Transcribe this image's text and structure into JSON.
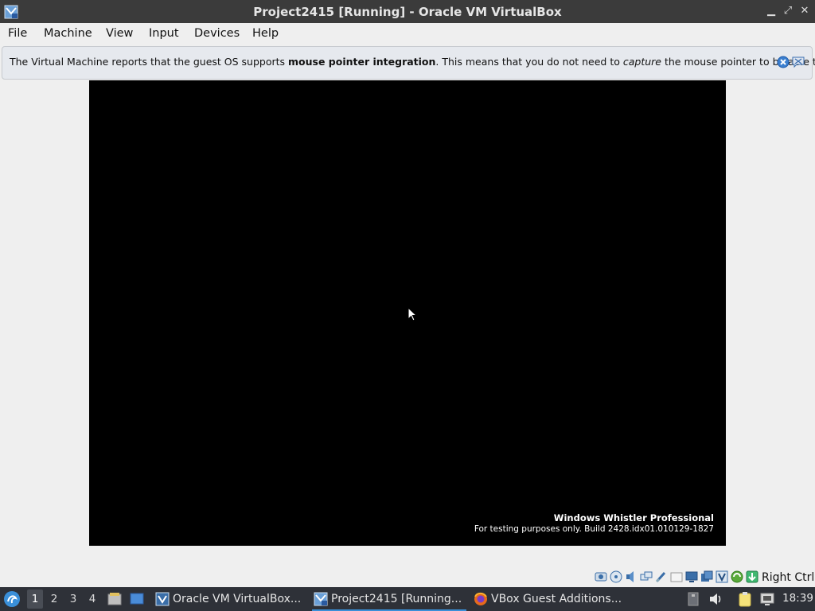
{
  "window": {
    "title": "Project2415 [Running] - Oracle VM VirtualBox"
  },
  "menu": {
    "items": [
      "File",
      "Machine",
      "View",
      "Input",
      "Devices",
      "Help"
    ]
  },
  "notice": {
    "part1": "The Virtual Machine reports that the guest OS supports ",
    "bold": "mouse pointer integration",
    "part2": ". This means that you do not need to ",
    "italic": "capture",
    "part3": " the mouse pointer to be able to"
  },
  "guest": {
    "watermark_title": "Windows Whistler Professional",
    "watermark_build": "For testing purposes only. Build 2428.idx01.010129-1827"
  },
  "statusbar": {
    "host_key": "Right Ctrl",
    "icons": [
      "hard-disk-icon",
      "optical-drive-icon",
      "audio-icon",
      "network-icon",
      "usb-icon",
      "shared-folders-icon",
      "display-icon",
      "recording-icon",
      "vrde-icon",
      "guest-additions-icon",
      "mouse-integration-icon"
    ]
  },
  "taskbar": {
    "workspaces": [
      "1",
      "2",
      "3",
      "4"
    ],
    "tasks": [
      {
        "label": "Oracle VM VirtualBox..."
      },
      {
        "label": "Project2415 [Running..."
      },
      {
        "label": "VBox Guest Additions..."
      }
    ],
    "clock": "18:39"
  },
  "colors": {
    "titlebar": "#3b3b3b",
    "taskbar": "#2e3138",
    "accent": "#3a8fd8",
    "guest_screen": "#000000"
  }
}
